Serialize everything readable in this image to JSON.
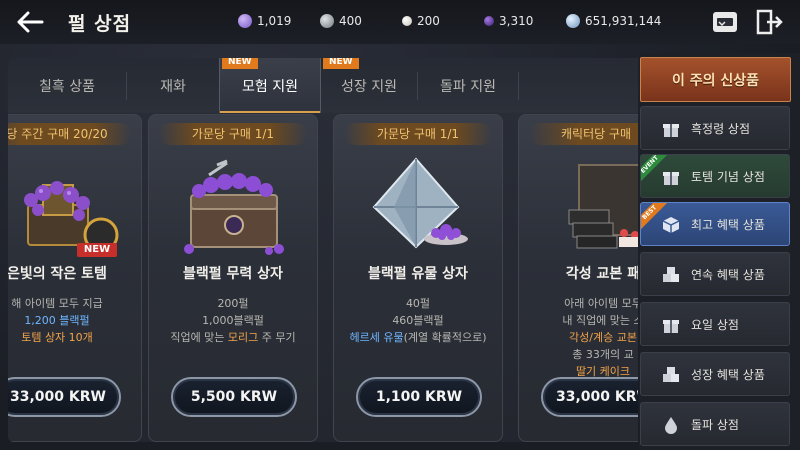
{
  "header": {
    "title": "펄 상점",
    "currencies": [
      {
        "icon": "purple-gem-icon",
        "value": "1,019",
        "color": "#9b7bd8"
      },
      {
        "icon": "silver-coin-icon",
        "value": "400",
        "color": "#9aa3a8"
      },
      {
        "icon": "white-pearl-icon",
        "value": "200",
        "color": "#e6e0d6"
      },
      {
        "icon": "black-pearl-icon",
        "value": "3,310",
        "color": "#6b3bb6"
      },
      {
        "icon": "diamond-icon",
        "value": "651,931,144",
        "color": "#a9c7e6"
      }
    ]
  },
  "tabs": [
    {
      "label": "칠흑 상품",
      "new": false
    },
    {
      "label": "재화",
      "new": false
    },
    {
      "label": "모험 지원",
      "new": true,
      "active": true
    },
    {
      "label": "성장 지원",
      "new": true
    },
    {
      "label": "돌파 지원",
      "new": false
    }
  ],
  "new_badge": "NEW",
  "cards": [
    {
      "limit": "당 주간 구매 20/20",
      "name": "은빛의 작은 토템",
      "badge": "NEW",
      "lines": [
        "해 아이템 모두 지급",
        "1,200 블랙펄",
        "토템 상자 10개"
      ],
      "price": "33,000 KRW"
    },
    {
      "limit": "가문당 구매 1/1",
      "name": "블랙펄 무력 상자",
      "lines": [
        "200펄",
        "1,000블랙펄",
        "직업에 맞는 ",
        "모리그",
        " 주 무기"
      ],
      "price": "5,500 KRW"
    },
    {
      "limit": "가문당 구매 1/1",
      "name": "블랙펄 유물 상자",
      "lines": [
        "40펄",
        "460블랙펄",
        "헤르세 유물",
        "(계열 확률적으로)"
      ],
      "price": "1,100 KRW"
    },
    {
      "limit": "캐릭터당 구매",
      "name": "각성 교본 패",
      "lines": [
        "아래 아이템 모두",
        "내 직업에 맞는 스",
        "각성/계승 교본",
        "총 33개의 교",
        "딸기 케이크"
      ],
      "price": "33,000 KRW"
    }
  ],
  "sidebar": {
    "banner": "이 주의 신상품",
    "items": [
      {
        "label": "흑정령 상점",
        "icon": "gift-icon"
      },
      {
        "label": "토템 기념 상점",
        "icon": "gift-icon",
        "ribbon": "EVENT"
      },
      {
        "label": "최고 혜택 상품",
        "icon": "cube-icon",
        "ribbon": "BEST",
        "active": true
      },
      {
        "label": "연속 혜택 상품",
        "icon": "boxes-icon"
      },
      {
        "label": "요일 상점",
        "icon": "gift-icon"
      },
      {
        "label": "성장 혜택 상품",
        "icon": "boxes-icon"
      },
      {
        "label": "돌파 상점",
        "icon": "drop-icon"
      }
    ]
  }
}
